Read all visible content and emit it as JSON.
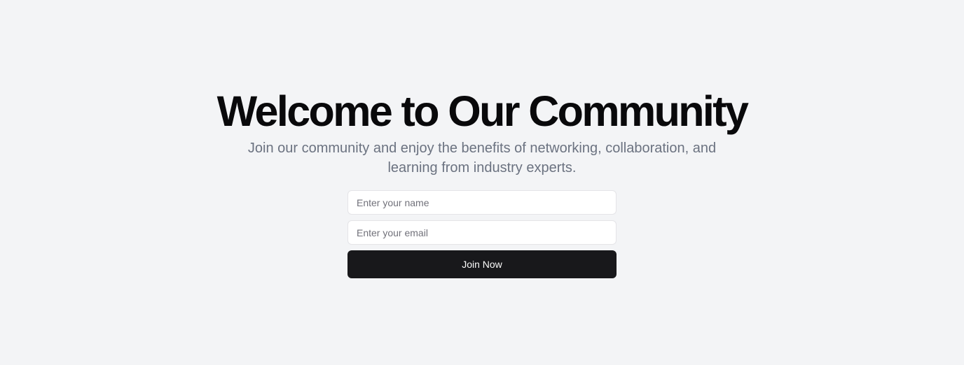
{
  "hero": {
    "title": "Welcome to Our Community",
    "subtitle": "Join our community and enjoy the benefits of networking, collaboration, and learning from industry experts."
  },
  "form": {
    "name_placeholder": "Enter your name",
    "name_value": "",
    "email_placeholder": "Enter your email",
    "email_value": "",
    "submit_label": "Join Now"
  },
  "colors": {
    "background": "#f3f4f6",
    "title": "#09090b",
    "subtitle": "#6b7280",
    "button": "#18181b",
    "button_text": "#fafafa",
    "input_border": "#e4e4e7"
  }
}
